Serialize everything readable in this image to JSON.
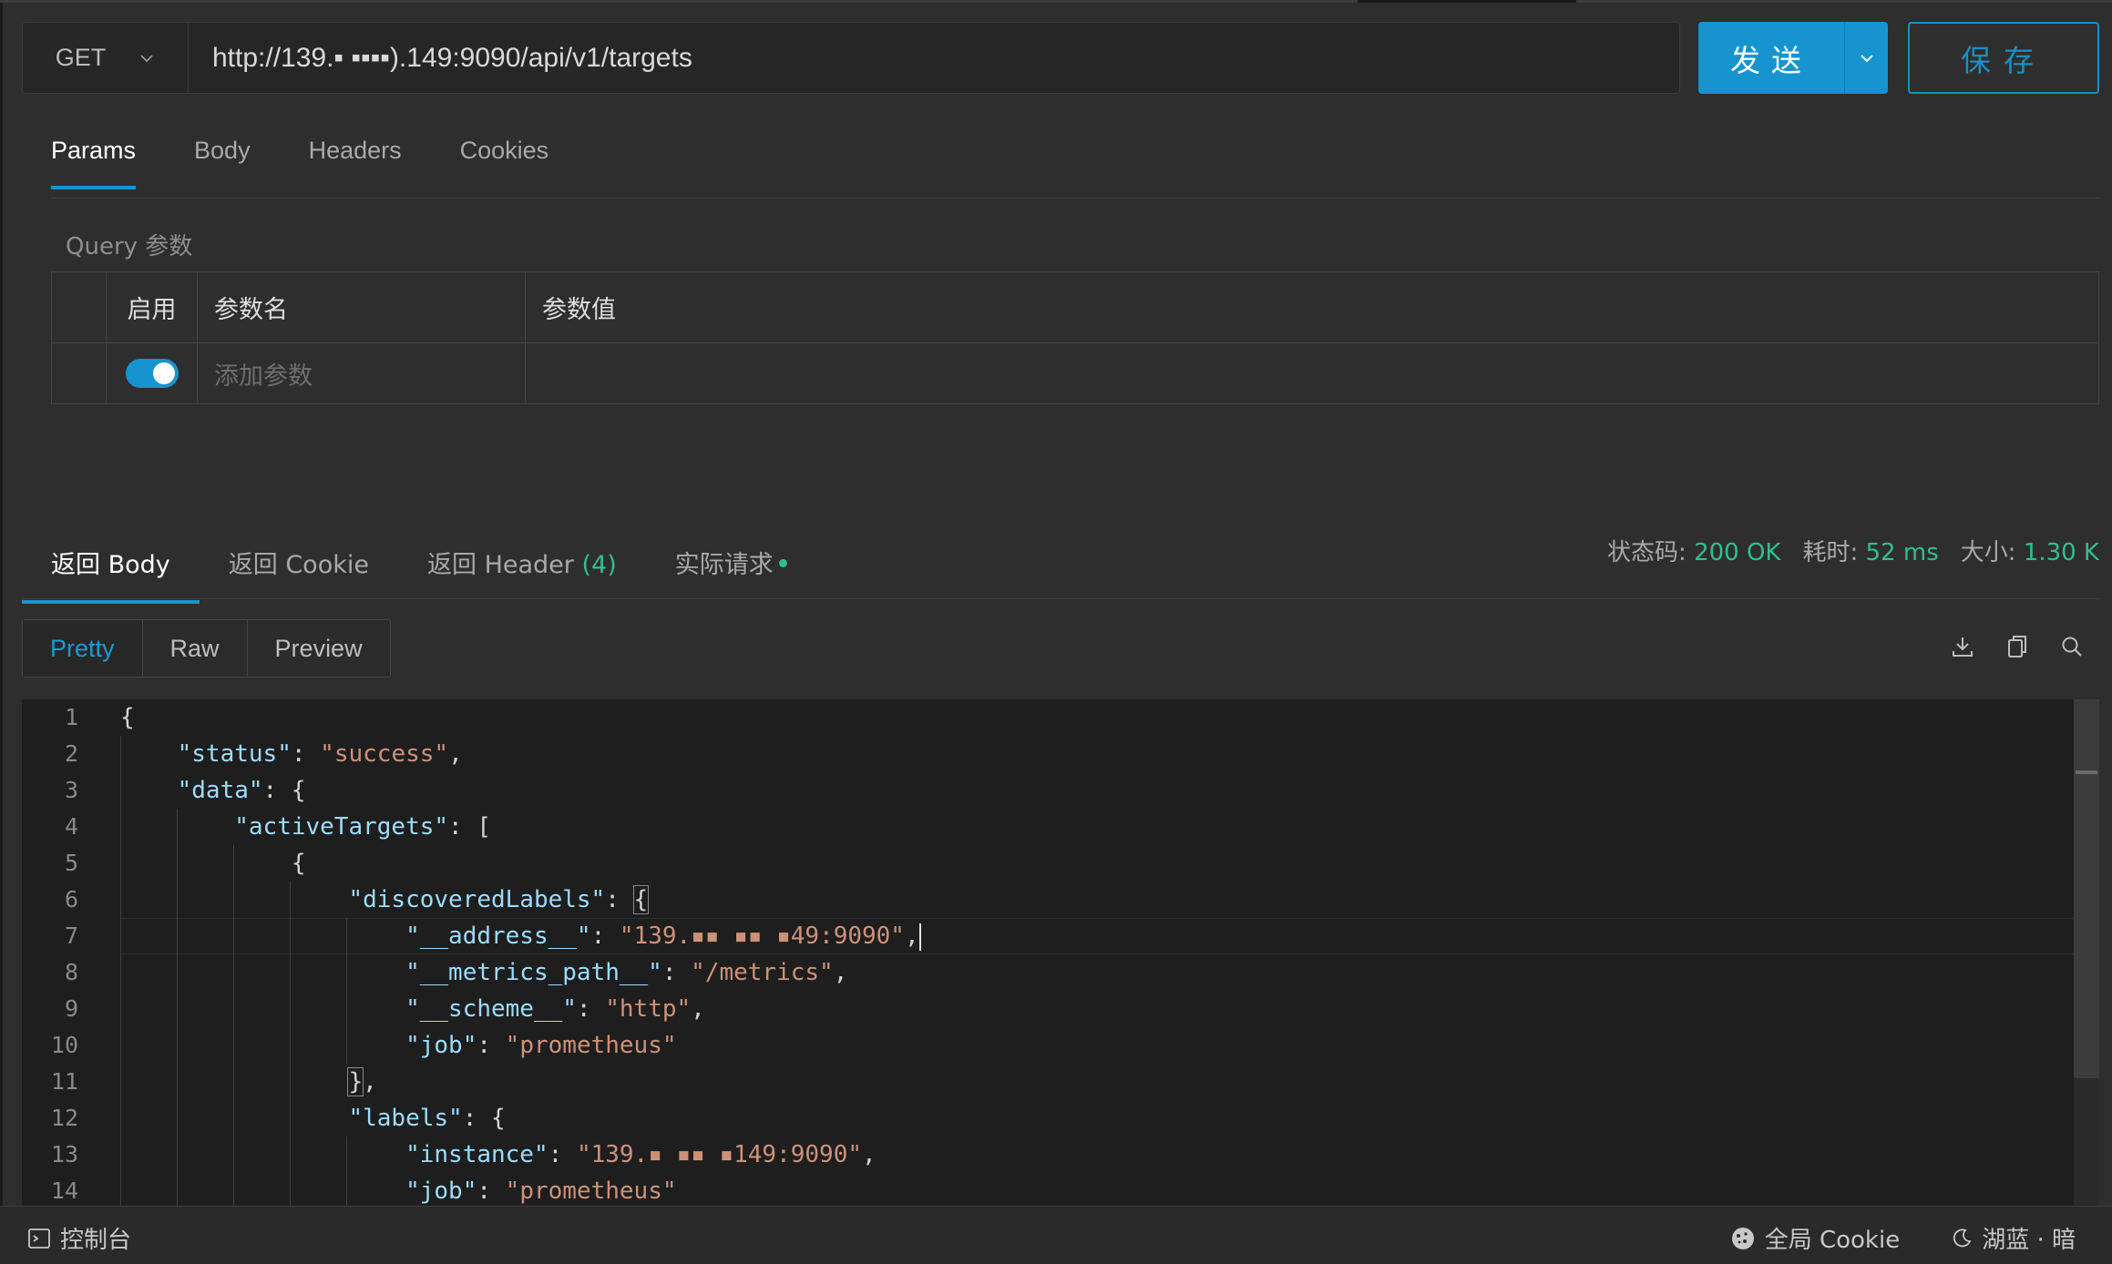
{
  "request": {
    "method": "GET",
    "url": "http://139.▪ ▪▪▪▪).149:9090/api/v1/targets",
    "send_label": "发送",
    "save_label": "保存"
  },
  "request_tabs": [
    "Params",
    "Body",
    "Headers",
    "Cookies"
  ],
  "query": {
    "section_label": "Query 参数",
    "columns": [
      "启用",
      "参数名",
      "参数值"
    ],
    "placeholder_row": {
      "enabled": true,
      "name_placeholder": "添加参数"
    }
  },
  "response_tabs": {
    "body": "返回 Body",
    "cookie": "返回 Cookie",
    "header": "返回 Header",
    "header_count": "(4)",
    "actual": "实际请求"
  },
  "status": {
    "code_label": "状态码:",
    "code_value": "200 OK",
    "time_label": "耗时:",
    "time_value": "52 ms",
    "size_label": "大小:",
    "size_value": "1.30 K"
  },
  "view_modes": [
    "Pretty",
    "Raw",
    "Preview"
  ],
  "toolbar_icons": [
    "download-icon",
    "copy-icon",
    "search-icon"
  ],
  "code": {
    "line_numbers": [
      "1",
      "2",
      "3",
      "4",
      "5",
      "6",
      "7",
      "8",
      "9",
      "10",
      "11",
      "12",
      "13",
      "14"
    ],
    "status_key": "\"status\"",
    "status_val": "\"success\"",
    "data_key": "\"data\"",
    "active_key": "\"activeTargets\"",
    "discovered_key": "\"discoveredLabels\"",
    "address_key": "\"__address__\"",
    "address_val": "\"139.▪▪ ▪▪ ▪49:9090\"",
    "metrics_key": "\"__metrics_path__\"",
    "metrics_val": "\"/metrics\"",
    "scheme_key": "\"__scheme__\"",
    "scheme_val": "\"http\"",
    "job_key": "\"job\"",
    "job_val": "\"prometheus\"",
    "labels_key": "\"labels\"",
    "instance_key": "\"instance\"",
    "instance_val": "\"139.▪ ▪▪ ▪149:9090\""
  },
  "statusbar": {
    "console": "控制台",
    "global_cookie": "全局 Cookie",
    "theme": "湖蓝 · 暗"
  },
  "colors": {
    "accent": "#1594cf",
    "success": "#2fbf8f",
    "json_key": "#9cdcfe",
    "json_string": "#ce9178"
  }
}
